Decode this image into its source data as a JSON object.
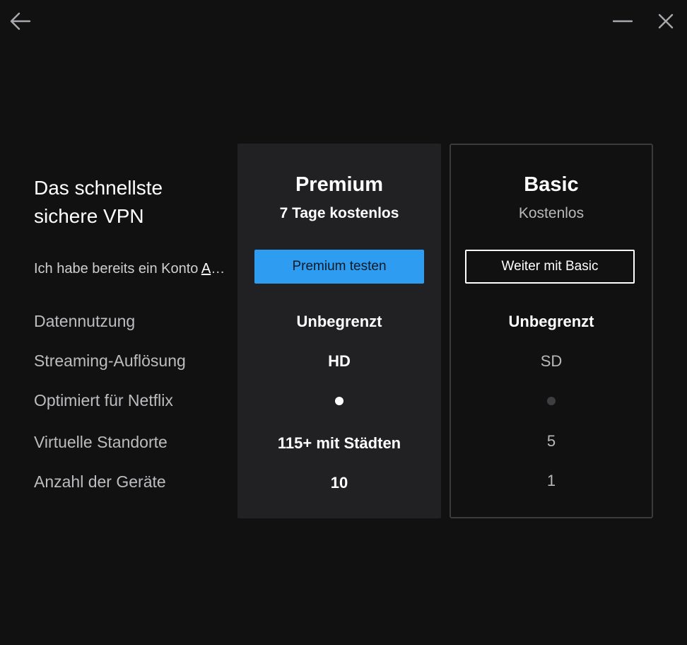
{
  "window": {
    "back_icon": "arrow-left-icon",
    "minimize_icon": "minimize-icon",
    "close_icon": "close-icon"
  },
  "intro": {
    "headline": "Das schnellste sichere VPN",
    "have_account_text": "Ich habe bereits ein Konto ",
    "have_account_link": "Anmelden"
  },
  "features": [
    "Datennutzung",
    "Streaming-Auflösung",
    "Optimiert für Netflix",
    "Virtuelle Standorte",
    "Anzahl der Geräte"
  ],
  "plans": {
    "premium": {
      "name": "Premium",
      "subtitle": "7 Tage kostenlos",
      "cta": "Premium testen",
      "data_usage": "Unbegrenzt",
      "streaming": "HD",
      "netflix_optimized": true,
      "locations": "115+ mit Städten",
      "devices": "10"
    },
    "basic": {
      "name": "Basic",
      "subtitle": "Kostenlos",
      "cta": "Weiter mit Basic",
      "data_usage": "Unbegrenzt",
      "streaming": "SD",
      "netflix_optimized": false,
      "locations": "5",
      "devices": "1"
    }
  },
  "colors": {
    "background": "#111112",
    "premium_card": "#212123",
    "accent": "#2e9cf0"
  }
}
